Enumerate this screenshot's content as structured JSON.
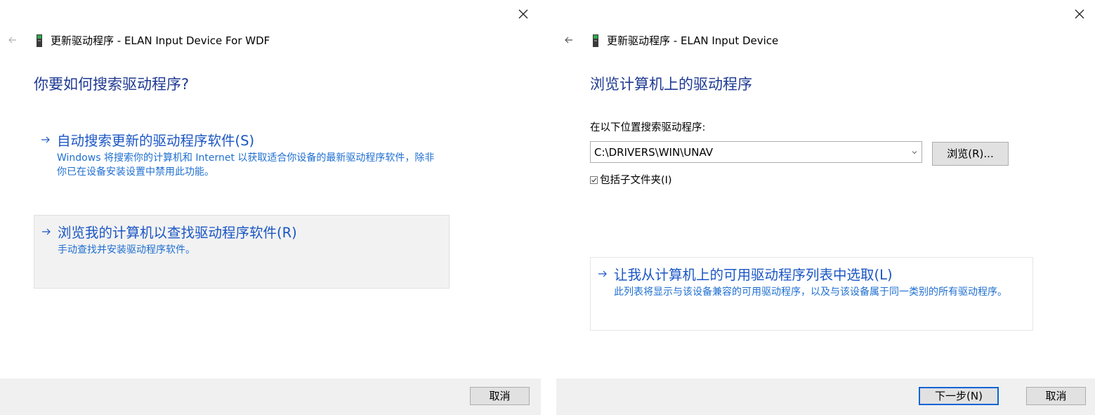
{
  "left_dialog": {
    "header_title": "更新驱动程序 - ELAN Input Device For WDF",
    "page_title": "你要如何搜索驱动程序?",
    "options": [
      {
        "title": "自动搜索更新的驱动程序软件(S)",
        "description": "Windows 将搜索你的计算机和 Internet 以获取适合你设备的最新驱动程序软件，除非你已在设备安装设置中禁用此功能。"
      },
      {
        "title": "浏览我的计算机以查找驱动程序软件(R)",
        "description": "手动查找并安装驱动程序软件。"
      }
    ],
    "cancel_label": "取消"
  },
  "right_dialog": {
    "header_title": "更新驱动程序 - ELAN Input Device",
    "page_title": "浏览计算机上的驱动程序",
    "search_label": "在以下位置搜索驱动程序:",
    "path_value": "C:\\DRIVERS\\WIN\\UNAV",
    "browse_label": "浏览(R)...",
    "include_subfolders_label": "包括子文件夹(I)",
    "include_subfolders_checked": true,
    "list_option": {
      "title": "让我从计算机上的可用驱动程序列表中选取(L)",
      "description": "此列表将显示与该设备兼容的可用驱动程序，以及与该设备属于同一类别的所有驱动程序。"
    },
    "next_label": "下一步(N)",
    "cancel_label": "取消"
  },
  "icons": {
    "close": "close-icon",
    "back": "back-arrow-icon",
    "device": "device-icon",
    "option_arrow": "right-arrow-icon",
    "dropdown": "chevron-down-icon",
    "checkbox": "checkbox-icon"
  },
  "colors": {
    "title_blue": "#1f3a93",
    "link_blue": "#1a56c4",
    "footer_bg": "#f0f0f0",
    "default_button_border": "#0a64d6"
  }
}
